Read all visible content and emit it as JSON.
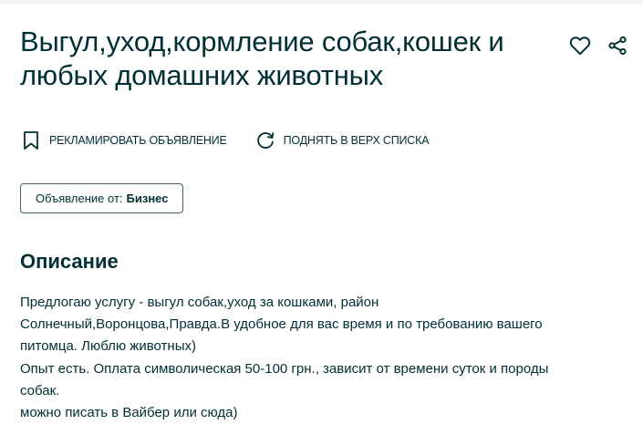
{
  "ad": {
    "title": "Выгул,уход,кормление собак,кошек и любых домашних животных"
  },
  "header_icons": {
    "favorite": "heart-icon",
    "share": "share-icon"
  },
  "actions": {
    "promote_label": "Рекламировать объявление",
    "promote_icon": "bookmark-icon",
    "raise_label": "Поднять в верх списка",
    "raise_icon": "refresh-icon"
  },
  "seller": {
    "prefix": "Объявление от:",
    "type": "Бизнес"
  },
  "description": {
    "heading": "Описание",
    "lines": [
      "Предлогаю услугу - выгул собак,уход за кошками, район",
      "Солнечный,Воронцова,Правда.В удобное для вас время и по требованию вашего",
      "питомца. Люблю животных)",
      "Опыт есть. Оплата символическая 50-100 грн., зависит от времени суток и породы",
      "собак.",
      "можно писать в Вайбер или сюда)"
    ]
  },
  "colors": {
    "text": "#002f34",
    "border": "#406367",
    "icon": "#002f34"
  }
}
